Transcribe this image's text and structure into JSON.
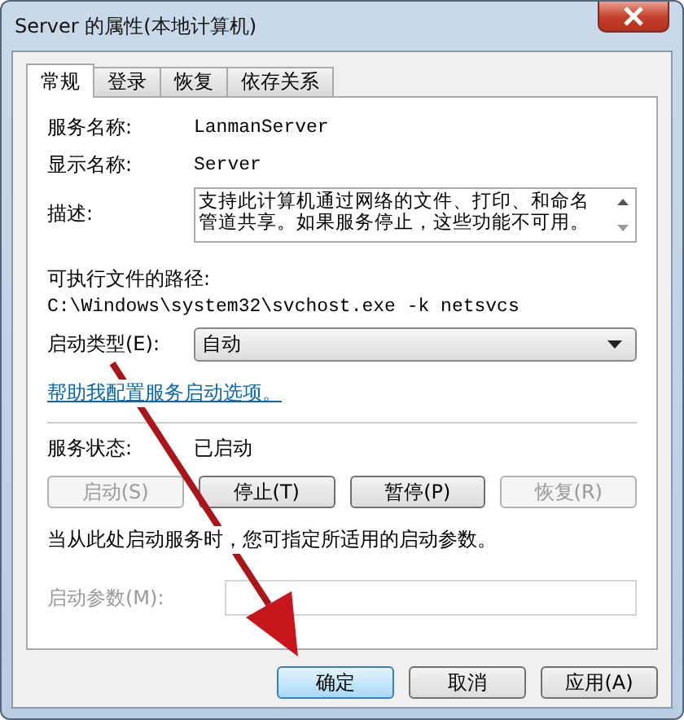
{
  "window": {
    "title": "Server 的属性(本地计算机)"
  },
  "tabs": [
    {
      "label": "常规",
      "selected": true
    },
    {
      "label": "登录",
      "selected": false
    },
    {
      "label": "恢复",
      "selected": false
    },
    {
      "label": "依存关系",
      "selected": false
    }
  ],
  "service_name": {
    "label": "服务名称:",
    "value": "LanmanServer"
  },
  "display_name": {
    "label": "显示名称:",
    "value": "Server"
  },
  "description": {
    "label": "描述:",
    "value": "支持此计算机通过网络的文件、打印、和命名管道共享。如果服务停止，这些功能不可用。"
  },
  "executable_path": {
    "label": "可执行文件的路径:",
    "value": "C:\\Windows\\system32\\svchost.exe -k netsvcs"
  },
  "startup_type": {
    "label": "启动类型(E):",
    "value": "自动"
  },
  "help_link": "帮助我配置服务启动选项。",
  "service_status": {
    "label": "服务状态:",
    "value": "已启动"
  },
  "control_buttons": [
    {
      "label": "启动(S)",
      "disabled": true
    },
    {
      "label": "停止(T)",
      "disabled": false
    },
    {
      "label": "暂停(P)",
      "disabled": false
    },
    {
      "label": "恢复(R)",
      "disabled": true
    }
  ],
  "hint": "当从此处启动服务时，您可指定所适用的启动参数。",
  "start_parameters": {
    "label": "启动参数(M):",
    "disabled": true
  },
  "buttons": [
    {
      "label": "确定",
      "default": true
    },
    {
      "label": "取消",
      "default": false
    },
    {
      "label": "应用(A)",
      "default": false
    }
  ]
}
